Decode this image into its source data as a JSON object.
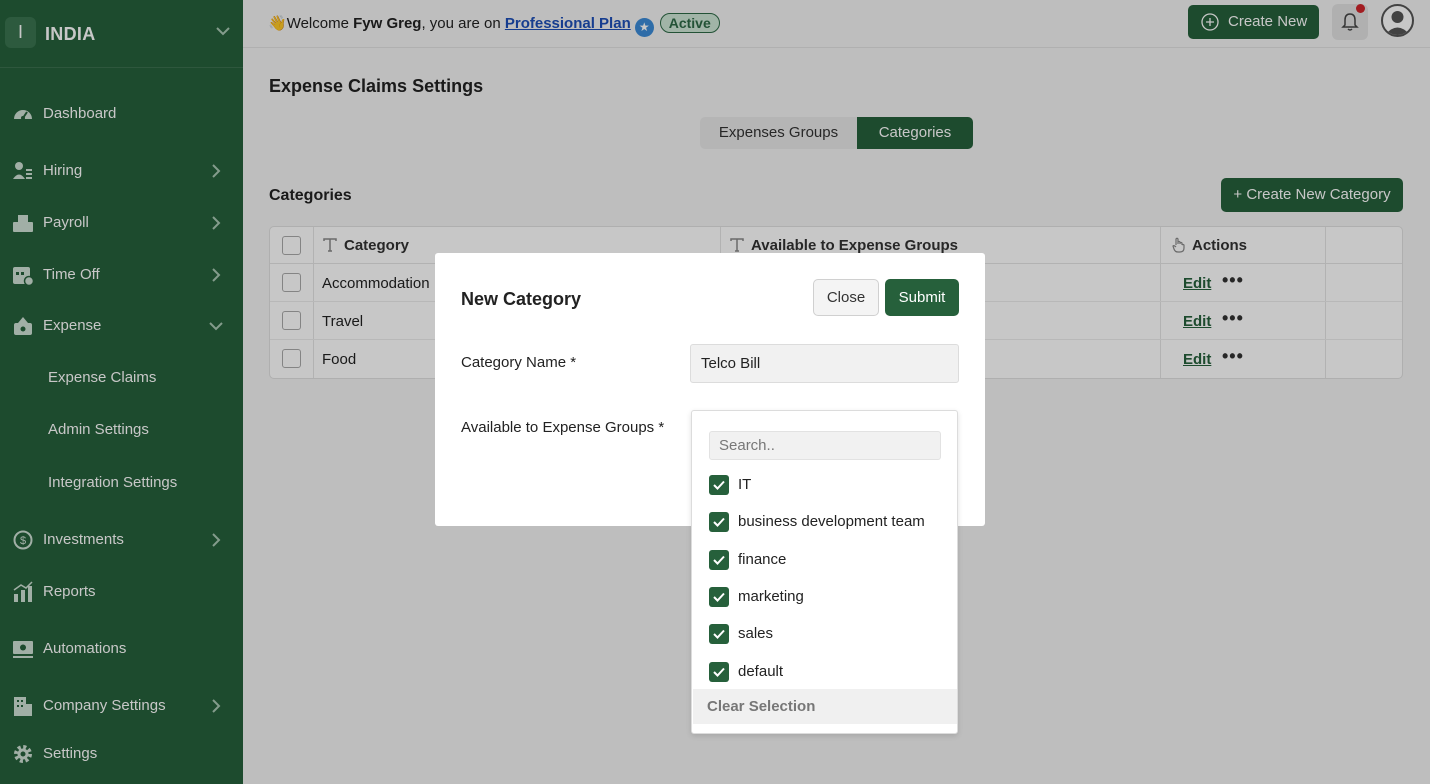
{
  "sidebar": {
    "org_initial": "I",
    "org_name": "INDIA",
    "items": [
      {
        "label": "Dashboard"
      },
      {
        "label": "Hiring"
      },
      {
        "label": "Payroll"
      },
      {
        "label": "Time Off"
      },
      {
        "label": "Expense"
      },
      {
        "label": "Investments"
      },
      {
        "label": "Reports"
      },
      {
        "label": "Automations"
      },
      {
        "label": "Company Settings"
      },
      {
        "label": "Settings"
      }
    ],
    "expense_sub": [
      {
        "label": "Expense Claims"
      },
      {
        "label": "Admin Settings"
      },
      {
        "label": "Integration Settings"
      }
    ]
  },
  "topbar": {
    "wave": "👋",
    "welcome_prefix": "Welcome ",
    "user_name": "Fyw Greg",
    "welcome_suffix": ", you are on ",
    "plan": "Professional Plan",
    "status": "Active",
    "create_new": "Create New"
  },
  "main": {
    "page_title": "Expense Claims Settings",
    "tabs": [
      {
        "label": "Expenses Groups"
      },
      {
        "label": "Categories"
      }
    ],
    "section_title": "Categories",
    "create_category": "+ Create New Category",
    "table": {
      "headers": [
        "Category",
        "Available to Expense Groups",
        "Actions"
      ],
      "rows": [
        {
          "category": "Accommodation",
          "action": "Edit"
        },
        {
          "category": "Travel",
          "action": "Edit"
        },
        {
          "category": "Food",
          "action": "Edit"
        }
      ],
      "more_glyph": "•••"
    }
  },
  "modal": {
    "title": "New Category",
    "close": "Close",
    "submit": "Submit",
    "name_label": "Category Name *",
    "name_value": "Telco Bill",
    "groups_label": "Available to Expense Groups *",
    "search_placeholder": "Search..",
    "options": [
      {
        "label": "IT",
        "checked": true
      },
      {
        "label": "business development team",
        "checked": true
      },
      {
        "label": "finance",
        "checked": true
      },
      {
        "label": "marketing",
        "checked": true
      },
      {
        "label": "sales",
        "checked": true
      },
      {
        "label": "default",
        "checked": true
      }
    ],
    "clear_selection": "Clear Selection"
  },
  "colors": {
    "brand": "#26603b",
    "alert": "#d0242b",
    "link": "#1d4fb8"
  }
}
